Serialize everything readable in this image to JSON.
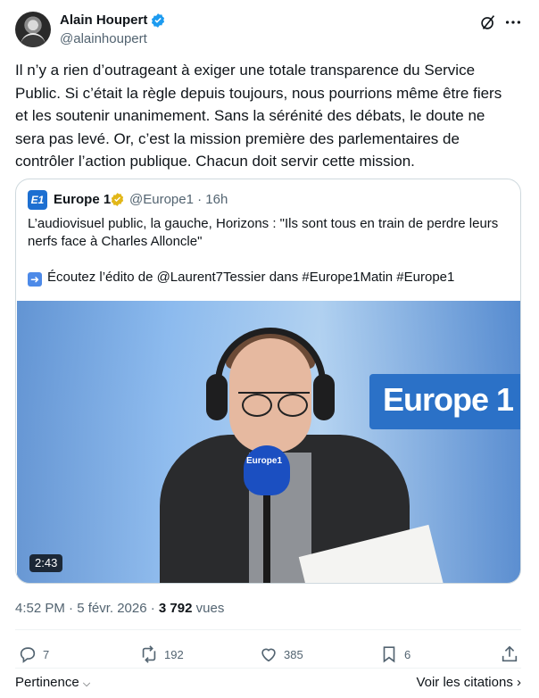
{
  "author": {
    "name": "Alain Houpert",
    "handle": "@alainhoupert"
  },
  "tweet": {
    "lines": [
      "Il n’y a rien d’outrageant à exiger une totale transparence du Service",
      "Public. Si c’était la règle depuis toujours, nous pourrions même être fiers",
      "et les soutenir unanimement. Sans la sérénité des débats, le doute ne",
      "sera pas levé. Or, c’est la mission première des parlementaires de",
      "contrôler l’action publique. Chacun doit servir cette mission."
    ]
  },
  "quote": {
    "logo_text": "E1",
    "name": "Europe 1",
    "meta": "@Europe1 · 16h",
    "lines": [
      "L’audiovisuel public, la gauche, Horizons : \"Ils sont tous en train de perdre leurs",
      "nerfs face à Charles Alloncle\""
    ],
    "link_line": "Écoutez l’édito de @Laurent7Tessier dans #Europe1Matin #Europe1",
    "video": {
      "sign_text": "Europe 1",
      "mic_label": "Europe1",
      "duration": "2:43"
    }
  },
  "timestamp": {
    "date": "4:52 PM · 5 févr. 2026 · ",
    "views_count": "3 792",
    "views_label": " vues"
  },
  "actions": {
    "replies": "7",
    "reposts": "192",
    "likes": "385",
    "bookmarks": "6"
  },
  "footer": {
    "pertinence": "Pertinence",
    "citations": "Voir les citations"
  },
  "colors": {
    "verified": "#1d9bf0",
    "gold_verified": "#e2b719",
    "muted": "#536471",
    "border": "#cfd9de"
  }
}
